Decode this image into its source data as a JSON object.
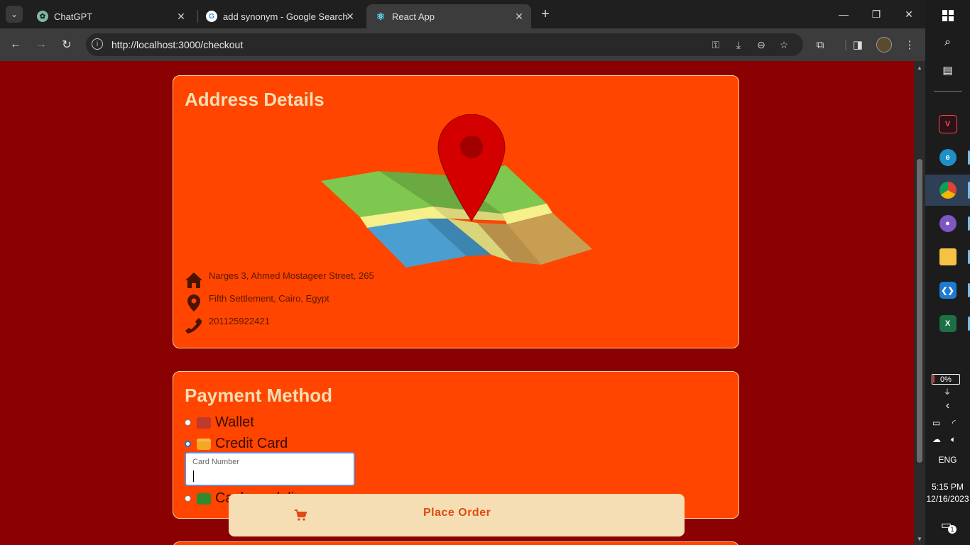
{
  "browser": {
    "tabs": [
      {
        "title": "ChatGPT",
        "icon": "chatgpt-icon"
      },
      {
        "title": "add synonym - Google Search",
        "icon": "google-icon"
      },
      {
        "title": "React App",
        "icon": "react-icon",
        "active": true
      }
    ],
    "url": "http://localhost:3000/checkout"
  },
  "address": {
    "title": "Address Details",
    "street": "Narges 3, Ahmed Mostageer Street, 265",
    "city": "Fifth Settlement, Cairo, Egypt",
    "phone": "201125922421"
  },
  "payment": {
    "title": "Payment Method",
    "options": [
      {
        "label": "Wallet",
        "selected": false,
        "icon": "wallet-icon"
      },
      {
        "label": "Credit Card",
        "selected": true,
        "icon": "credit-card-icon"
      },
      {
        "label": "Cash on delivery",
        "selected": false,
        "icon": "cash-icon"
      }
    ],
    "card_input": {
      "label": "Card Number",
      "value": ""
    }
  },
  "place_order": {
    "label": "Place Order"
  },
  "taskbar": {
    "battery": "0%",
    "language": "ENG",
    "time": "5:15 PM",
    "date": "12/16/2023",
    "notifications": "1"
  },
  "colors": {
    "page_bg": "#8b0000",
    "card_bg": "#ff4500",
    "title_color": "#f5deb3",
    "button_bg": "#f5deb3"
  }
}
